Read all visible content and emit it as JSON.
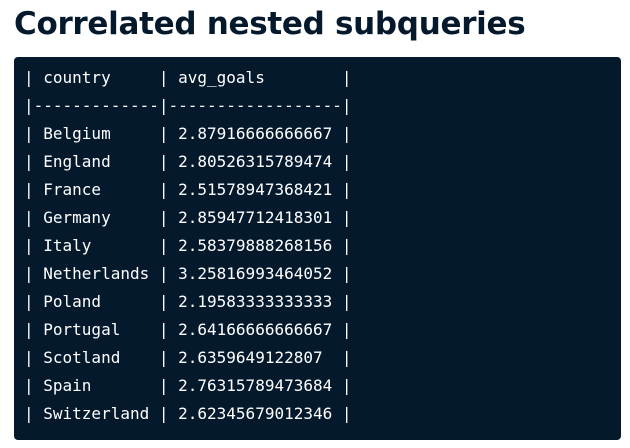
{
  "slide": {
    "title": "Correlated nested subqueries"
  },
  "output": {
    "lines": [
      "| country     | avg_goals        |",
      "|-------------|------------------|",
      "| Belgium     | 2.87916666666667 |",
      "| England     | 2.80526315789474 |",
      "| France      | 2.51578947368421 |",
      "| Germany     | 2.85947712418301 |",
      "| Italy       | 2.58379888268156 |",
      "| Netherlands | 3.25816993464052 |",
      "| Poland      | 2.19583333333333 |",
      "| Portugal    | 2.64166666666667 |",
      "| Scotland    | 2.6359649122807  |",
      "| Spain       | 2.76315789473684 |",
      "| Switzerland | 2.62345679012346 |"
    ]
  },
  "colors": {
    "title": "#05192d",
    "panel_background": "#05192d",
    "panel_text": "#ffffff"
  }
}
